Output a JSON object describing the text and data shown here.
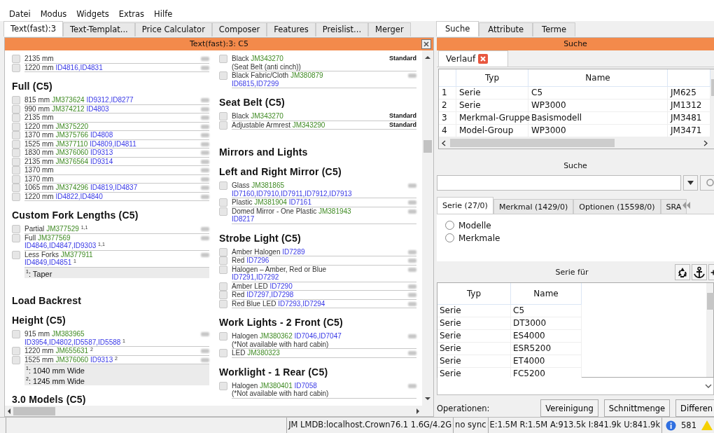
{
  "menu": [
    "Datei",
    "Modus",
    "Widgets",
    "Extras",
    "Hilfe"
  ],
  "tabs": [
    {
      "label": "Text(fast):3",
      "selected": true
    },
    {
      "label": "Text-Templat...",
      "selected": false
    },
    {
      "label": "Price Calculator",
      "selected": false
    },
    {
      "label": "Composer",
      "selected": false
    },
    {
      "label": "Features",
      "selected": false
    },
    {
      "label": "Preislist...",
      "selected": false
    },
    {
      "label": "Merger",
      "selected": false
    }
  ],
  "editor": {
    "title": "Text(fast):3: C5",
    "columns": [
      [
        {
          "kind": "item",
          "checked": false,
          "lines": [
            [
              {
                "kind": "plain",
                "text": "2135 mm"
              }
            ]
          ]
        },
        {
          "kind": "item",
          "checked": false,
          "lines": [
            [
              {
                "kind": "plain",
                "text": "1220 mm"
              },
              {
                "kind": "id",
                "text": "ID4816,ID4831"
              }
            ]
          ]
        },
        {
          "kind": "heading",
          "text": "Full (C5)"
        },
        {
          "kind": "item",
          "checked": false,
          "lines": [
            [
              {
                "kind": "plain",
                "text": "815 mm"
              },
              {
                "kind": "jm",
                "text": "JM373624"
              },
              {
                "kind": "id",
                "text": "ID9312,ID8277"
              }
            ]
          ]
        },
        {
          "kind": "item",
          "checked": false,
          "lines": [
            [
              {
                "kind": "plain",
                "text": "990 mm"
              },
              {
                "kind": "jm",
                "text": "JM374212"
              },
              {
                "kind": "id",
                "text": "ID4803"
              }
            ]
          ]
        },
        {
          "kind": "item",
          "checked": false,
          "lines": [
            [
              {
                "kind": "plain",
                "text": "2135 mm"
              }
            ]
          ]
        },
        {
          "kind": "item",
          "checked": false,
          "lines": [
            [
              {
                "kind": "plain",
                "text": "1220 mm"
              },
              {
                "kind": "jm",
                "text": "JM375220"
              }
            ]
          ]
        },
        {
          "kind": "item",
          "checked": false,
          "lines": [
            [
              {
                "kind": "plain",
                "text": "1370 mm"
              },
              {
                "kind": "jm",
                "text": "JM375766"
              },
              {
                "kind": "id",
                "text": "ID4808"
              }
            ]
          ]
        },
        {
          "kind": "item",
          "checked": false,
          "lines": [
            [
              {
                "kind": "plain",
                "text": "1525 mm"
              },
              {
                "kind": "jm",
                "text": "JM377110"
              },
              {
                "kind": "id",
                "text": "ID4809,ID4811"
              }
            ]
          ]
        },
        {
          "kind": "item",
          "checked": false,
          "lines": [
            [
              {
                "kind": "plain",
                "text": "1830 mm"
              },
              {
                "kind": "jm",
                "text": "JM376060"
              },
              {
                "kind": "id",
                "text": "ID9313"
              }
            ]
          ]
        },
        {
          "kind": "item",
          "checked": false,
          "lines": [
            [
              {
                "kind": "plain",
                "text": "2135 mm"
              },
              {
                "kind": "jm",
                "text": "JM376564"
              },
              {
                "kind": "id",
                "text": "ID9314"
              }
            ]
          ]
        },
        {
          "kind": "item",
          "checked": false,
          "lines": [
            [
              {
                "kind": "plain",
                "text": "1370 mm"
              }
            ]
          ]
        },
        {
          "kind": "item",
          "checked": false,
          "lines": [
            [
              {
                "kind": "plain",
                "text": "1370 mm"
              }
            ]
          ]
        },
        {
          "kind": "item",
          "checked": false,
          "lines": [
            [
              {
                "kind": "plain",
                "text": "1065 mm"
              },
              {
                "kind": "jm",
                "text": "JM374296"
              },
              {
                "kind": "id",
                "text": "ID4819,ID4837"
              }
            ]
          ]
        },
        {
          "kind": "item",
          "checked": false,
          "lines": [
            [
              {
                "kind": "plain",
                "text": "1220 mm"
              },
              {
                "kind": "id",
                "text": "ID4822,ID4840"
              }
            ]
          ]
        },
        {
          "kind": "heading",
          "text": "Custom Fork Lengths (C5)"
        },
        {
          "kind": "item",
          "checked": false,
          "lines": [
            [
              {
                "kind": "plain",
                "text": "Partial"
              },
              {
                "kind": "jm",
                "text": "JM377529"
              },
              {
                "kind": "sup",
                "text": "1,1"
              }
            ]
          ]
        },
        {
          "kind": "item",
          "checked": false,
          "lines": [
            [
              {
                "kind": "plain",
                "text": "Full"
              },
              {
                "kind": "jm",
                "text": "JM377569"
              }
            ],
            [
              {
                "kind": "id",
                "text": "ID4846,ID4847,ID9303"
              },
              {
                "kind": "sup",
                "text": "1,1"
              }
            ]
          ]
        },
        {
          "kind": "item",
          "checked": false,
          "lines": [
            [
              {
                "kind": "plain",
                "text": "Less Forks"
              },
              {
                "kind": "jm",
                "text": "JM377911"
              }
            ],
            [
              {
                "kind": "id",
                "text": "ID4849,ID4851"
              },
              {
                "kind": "sup",
                "text": "1"
              }
            ]
          ]
        },
        {
          "kind": "notes",
          "lines": [
            "$^{1}$: Taper"
          ]
        },
        {
          "kind": "section",
          "text": "Load Backrest"
        },
        {
          "kind": "heading",
          "text": "Height (C5)"
        },
        {
          "kind": "item",
          "checked": false,
          "lines": [
            [
              {
                "kind": "plain",
                "text": "915 mm"
              },
              {
                "kind": "jm",
                "text": "JM383965"
              }
            ],
            [
              {
                "kind": "id",
                "text": "ID3954,ID4802,ID5587,ID5588"
              },
              {
                "kind": "sup",
                "text": "1"
              }
            ]
          ]
        },
        {
          "kind": "item",
          "checked": false,
          "lines": [
            [
              {
                "kind": "plain",
                "text": "1220 mm"
              },
              {
                "kind": "jm",
                "text": "JM655631"
              },
              {
                "kind": "sup",
                "text": "2"
              }
            ]
          ]
        },
        {
          "kind": "item",
          "checked": false,
          "lines": [
            [
              {
                "kind": "plain",
                "text": "1525 mm"
              },
              {
                "kind": "jm",
                "text": "JM376060"
              },
              {
                "kind": "id",
                "text": "ID9313"
              },
              {
                "kind": "sup",
                "text": "2"
              }
            ]
          ]
        },
        {
          "kind": "notes",
          "lines": [
            "$^{1}$: 1040 mm Wide",
            "$^{2}$: 1245 mm Wide"
          ]
        },
        {
          "kind": "heading",
          "text": "3.0 Models (C5)"
        }
      ],
      [
        {
          "kind": "item",
          "checked": false,
          "price": "Standard",
          "lines": [
            [
              {
                "kind": "plain",
                "text": "Black"
              },
              {
                "kind": "jm",
                "text": "JM343270"
              }
            ],
            [
              {
                "kind": "plain",
                "text": "(Seat Belt (anti cinch))"
              }
            ]
          ]
        },
        {
          "kind": "item",
          "checked": false,
          "lines": [
            [
              {
                "kind": "plain",
                "text": "Black Fabric/Cloth"
              },
              {
                "kind": "jm",
                "text": "JM380879"
              }
            ],
            [
              {
                "kind": "id",
                "text": "ID6815,ID7299"
              }
            ]
          ]
        },
        {
          "kind": "heading",
          "text": "Seat Belt (C5)"
        },
        {
          "kind": "item",
          "checked": false,
          "price": "Standard",
          "lines": [
            [
              {
                "kind": "plain",
                "text": "Black"
              },
              {
                "kind": "jm",
                "text": "JM343270"
              }
            ]
          ]
        },
        {
          "kind": "item",
          "checked": false,
          "price": "Standard",
          "lines": [
            [
              {
                "kind": "plain",
                "text": "Adjustable Armrest"
              },
              {
                "kind": "jm",
                "text": "JM343290"
              }
            ]
          ]
        },
        {
          "kind": "section",
          "text": "Mirrors and Lights"
        },
        {
          "kind": "heading",
          "text": "Left and Right Mirror (C5)"
        },
        {
          "kind": "item",
          "checked": false,
          "lines": [
            [
              {
                "kind": "plain",
                "text": "Glass"
              },
              {
                "kind": "jm",
                "text": "JM381865"
              }
            ],
            [
              {
                "kind": "id",
                "text": "ID7160,ID7910,ID7911,ID7912,ID7913"
              }
            ]
          ]
        },
        {
          "kind": "item",
          "checked": false,
          "lines": [
            [
              {
                "kind": "plain",
                "text": "Plastic"
              },
              {
                "kind": "jm",
                "text": "JM381904"
              },
              {
                "kind": "id",
                "text": "ID7161"
              }
            ]
          ]
        },
        {
          "kind": "item",
          "checked": false,
          "lines": [
            [
              {
                "kind": "plain",
                "text": "Domed Mirror - One Plastic"
              },
              {
                "kind": "jm",
                "text": "JM381943"
              }
            ],
            [
              {
                "kind": "id",
                "text": "ID8217"
              }
            ]
          ]
        },
        {
          "kind": "heading",
          "text": "Strobe Light (C5)"
        },
        {
          "kind": "item",
          "checked": false,
          "lines": [
            [
              {
                "kind": "plain",
                "text": "Amber Halogen"
              },
              {
                "kind": "id",
                "text": "ID7289"
              }
            ]
          ]
        },
        {
          "kind": "item",
          "checked": false,
          "lines": [
            [
              {
                "kind": "plain",
                "text": "Red"
              },
              {
                "kind": "id",
                "text": "ID7296"
              }
            ]
          ]
        },
        {
          "kind": "item",
          "checked": false,
          "lines": [
            [
              {
                "kind": "plain",
                "text": "Halogen – Amber, Red or Blue"
              }
            ],
            [
              {
                "kind": "id",
                "text": "ID7291,ID7292"
              }
            ]
          ]
        },
        {
          "kind": "item",
          "checked": false,
          "lines": [
            [
              {
                "kind": "plain",
                "text": "Amber LED"
              },
              {
                "kind": "id",
                "text": "ID7290"
              }
            ]
          ]
        },
        {
          "kind": "item",
          "checked": false,
          "lines": [
            [
              {
                "kind": "plain",
                "text": "Red"
              },
              {
                "kind": "id",
                "text": "ID7297,ID7298"
              }
            ]
          ]
        },
        {
          "kind": "item",
          "checked": false,
          "lines": [
            [
              {
                "kind": "plain",
                "text": "Red Blue LED"
              },
              {
                "kind": "id",
                "text": "ID7293,ID7294"
              }
            ]
          ]
        },
        {
          "kind": "heading",
          "text": "Work Lights - 2 Front (C5)"
        },
        {
          "kind": "item",
          "checked": false,
          "lines": [
            [
              {
                "kind": "plain",
                "text": "Halogen"
              },
              {
                "kind": "jm",
                "text": "JM380362"
              },
              {
                "kind": "id",
                "text": "ID7046,ID7047"
              }
            ],
            [
              {
                "kind": "plain",
                "text": "(*Not available with hard cabin)"
              }
            ]
          ]
        },
        {
          "kind": "item",
          "checked": false,
          "lines": [
            [
              {
                "kind": "plain",
                "text": "LED"
              },
              {
                "kind": "jm",
                "text": "JM380323"
              }
            ]
          ]
        },
        {
          "kind": "heading",
          "text": "Worklight - 1 Rear (C5)"
        },
        {
          "kind": "item",
          "checked": false,
          "lines": [
            [
              {
                "kind": "plain",
                "text": "Halogen"
              },
              {
                "kind": "jm",
                "text": "JM380401"
              },
              {
                "kind": "id",
                "text": "ID7058"
              }
            ],
            [
              {
                "kind": "plain",
                "text": "(*Not available with hard cabin)"
              }
            ]
          ]
        }
      ]
    ]
  },
  "side_tabs": [
    {
      "label": "Suche",
      "selected": true
    },
    {
      "label": "Attribute",
      "selected": false
    },
    {
      "label": "Terme",
      "selected": false
    }
  ],
  "search_panel": {
    "title": "Suche",
    "history_tab": {
      "label": "Verlauf",
      "selected": true
    },
    "history": {
      "columns": [
        "Typ",
        "Name"
      ],
      "rows": [
        {
          "index": "1",
          "typ": "Serie",
          "name": "C5",
          "column_3": "JM625"
        },
        {
          "index": "2",
          "typ": "Serie",
          "name": "WP3000",
          "column_3": "JM1312"
        },
        {
          "index": "3",
          "typ": "Merkmal-Gruppe",
          "name": "Basismodell",
          "column_3": "JM3481"
        },
        {
          "index": "4",
          "typ": "Model-Group",
          "name": "WP3000",
          "column_3": "JM3471"
        }
      ]
    },
    "search_label": "Suche",
    "result_tabs": [
      {
        "label": "Serie (27/0)",
        "selected": true
      },
      {
        "label": "Merkmal (1429/0)",
        "selected": false
      },
      {
        "label": "Optionen (15598/0)",
        "selected": false
      },
      {
        "label": "SRA",
        "selected": false
      }
    ],
    "options": [
      {
        "label": "Modelle",
        "selected": false
      },
      {
        "label": "Merkmale",
        "selected": false
      }
    ],
    "series_title": "Serie für",
    "series": {
      "columns": [
        "Typ",
        "Name"
      ],
      "rows": [
        {
          "typ": "Serie",
          "name": "C5"
        },
        {
          "typ": "Serie",
          "name": "DT3000"
        },
        {
          "typ": "Serie",
          "name": "ES4000"
        },
        {
          "typ": "Serie",
          "name": "ESR5200"
        },
        {
          "typ": "Serie",
          "name": "ET4000"
        },
        {
          "typ": "Serie",
          "name": "FC5200"
        }
      ]
    },
    "operations_label": "Operationen:",
    "operations": [
      "Vereinigung",
      "Schnittmenge",
      "Differen"
    ]
  },
  "status_bar": {
    "database": "JM LMDB:localhost.Crown76.1 1.6G/4.2G",
    "sync": "no sync",
    "counts": "E:1.5M R:1.5M A:913.5k I:841.9k U:841.9k",
    "messages": "581"
  }
}
